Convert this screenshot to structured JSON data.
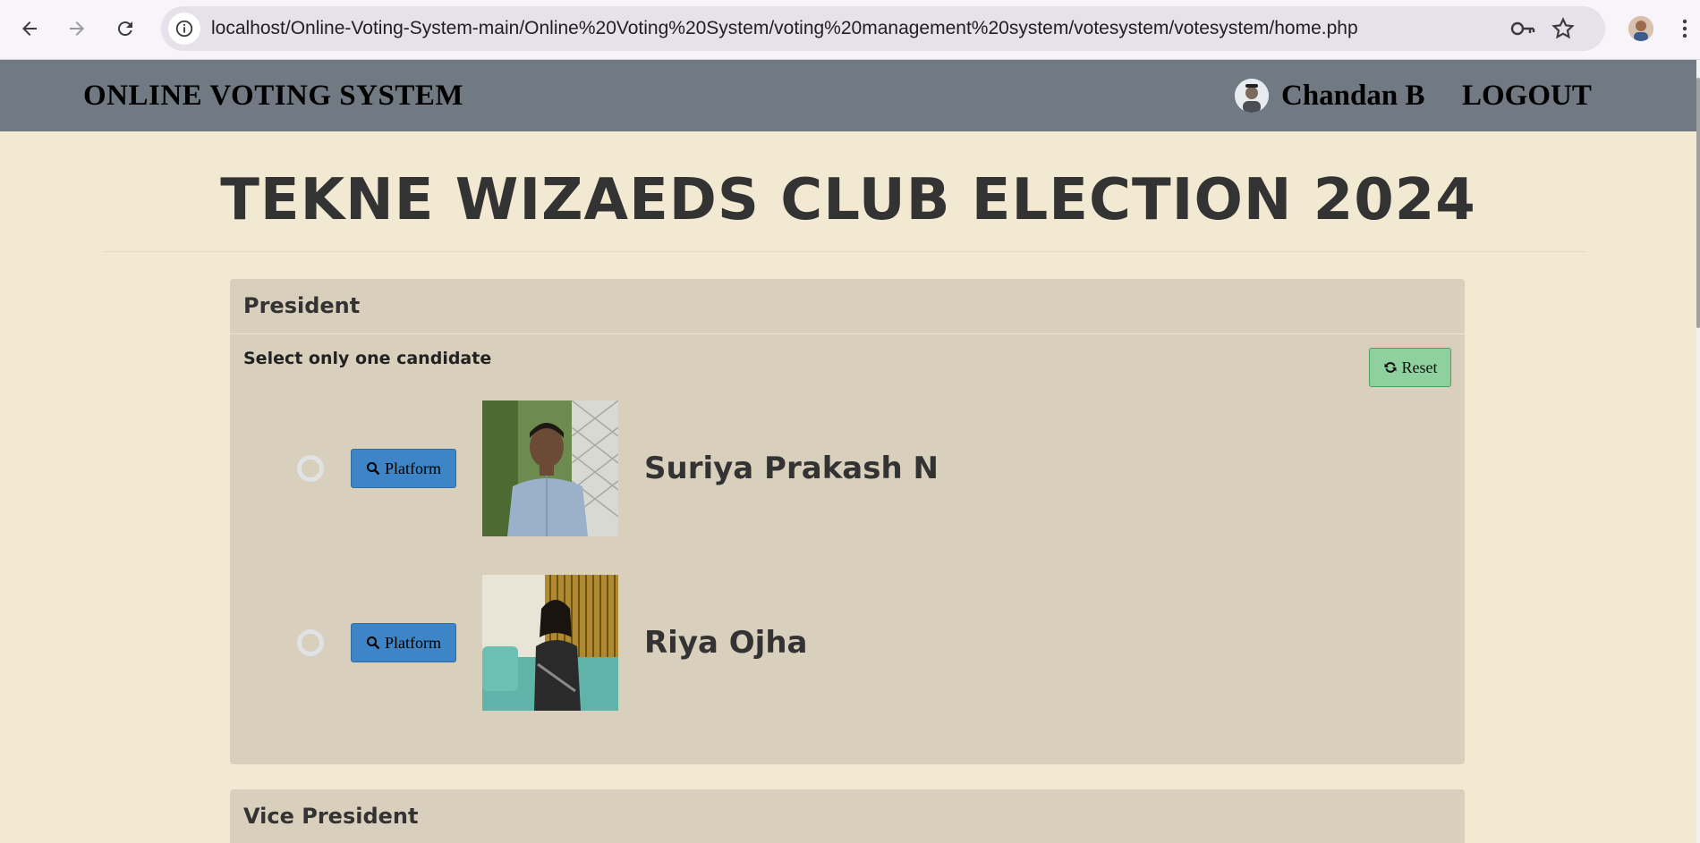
{
  "browser": {
    "url": "localhost/Online-Voting-System-main/Online%20Voting%20System/voting%20management%20system/votesystem/votesystem/home.php"
  },
  "header": {
    "brand": "ONLINE VOTING SYSTEM",
    "user_name": "Chandan B",
    "logout_label": "LOGOUT"
  },
  "election": {
    "title": "TEKNE WIZAEDS CLUB ELECTION 2024"
  },
  "positions": [
    {
      "title": "President",
      "instruction": "Select only one candidate",
      "reset_label": "Reset",
      "candidates": [
        {
          "name": "Suriya Prakash N",
          "platform_label": "Platform"
        },
        {
          "name": "Riya Ojha",
          "platform_label": "Platform"
        }
      ]
    },
    {
      "title": "Vice President"
    }
  ],
  "colors": {
    "page_bg": "#f2e9d3",
    "header_bg": "#717982",
    "panel_bg": "#d8d0bc",
    "platform_btn": "#3d85c6",
    "reset_btn": "#8fd19e"
  },
  "icons": {
    "back": "arrow-left-icon",
    "forward": "arrow-right-icon",
    "reload": "reload-icon",
    "site_info": "info-icon",
    "password": "key-icon",
    "bookmark": "star-icon",
    "menu": "kebab-menu-icon",
    "reset": "refresh-icon",
    "platform": "search-icon"
  }
}
